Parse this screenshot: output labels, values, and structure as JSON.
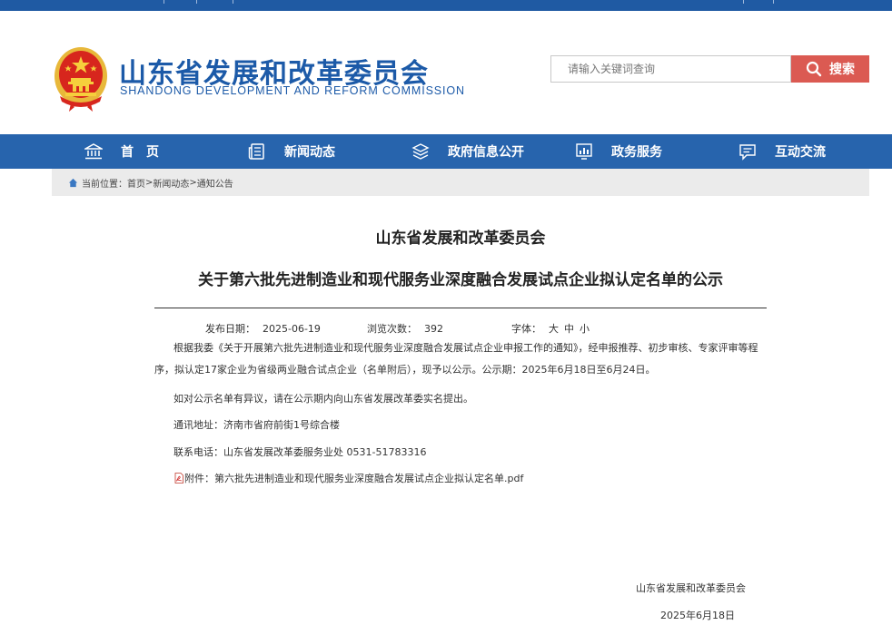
{
  "header": {
    "title": "山东省发展和改革委员会",
    "subtitle": "SHANDONG DEVELOPMENT AND REFORM COMMISSION",
    "search_placeholder": "请输入关键词查询",
    "search_button": "搜索"
  },
  "nav": {
    "items": [
      {
        "label": "首　页",
        "icon": "home-icon"
      },
      {
        "label": "新闻动态",
        "icon": "news-icon"
      },
      {
        "label": "政府信息公开",
        "icon": "layers-icon"
      },
      {
        "label": "政务服务",
        "icon": "chart-icon"
      },
      {
        "label": "互动交流",
        "icon": "chat-icon"
      }
    ]
  },
  "breadcrumb": {
    "prefix": "当前位置：",
    "items": [
      "首页",
      "新闻动态",
      "通知公告"
    ],
    "separator": ">"
  },
  "article": {
    "org_title": "山东省发展和改革委员会",
    "title": "关于第六批先进制造业和现代服务业深度融合发展试点企业拟认定名单的公示",
    "publish_label": "发布日期：",
    "publish_date": "2025-06-19",
    "views_label": "浏览次数：",
    "views": "392",
    "font_label": "字体：",
    "font_sizes": [
      "大",
      "中",
      "小"
    ],
    "paragraph1": "根据我委《关于开展第六批先进制造业和现代服务业深度融合发展试点企业申报工作的通知》，经申报推荐、初步审核、专家评审等程序，拟认定17家企业为省级两业融合试点企业（名单附后），现予以公示。公示期：2025年6月18日至6月24日。",
    "paragraph2": "如对公示名单有异议，请在公示期内向山东省发展改革委实名提出。",
    "address": "通讯地址：济南市省府前街1号综合楼",
    "contact": "联系电话：山东省发展改革委服务业处  0531-51783316",
    "attachment": "附件：第六批先进制造业和现代服务业深度融合发展试点企业拟认定名单.pdf",
    "sign_org": "山东省发展和改革委员会",
    "sign_date": "2025年6月18日"
  },
  "colors": {
    "brand_blue": "#1c5aa8",
    "nav_blue": "#2764ad",
    "search_red": "#db5a52",
    "crumb_bg": "#ebebeb"
  }
}
